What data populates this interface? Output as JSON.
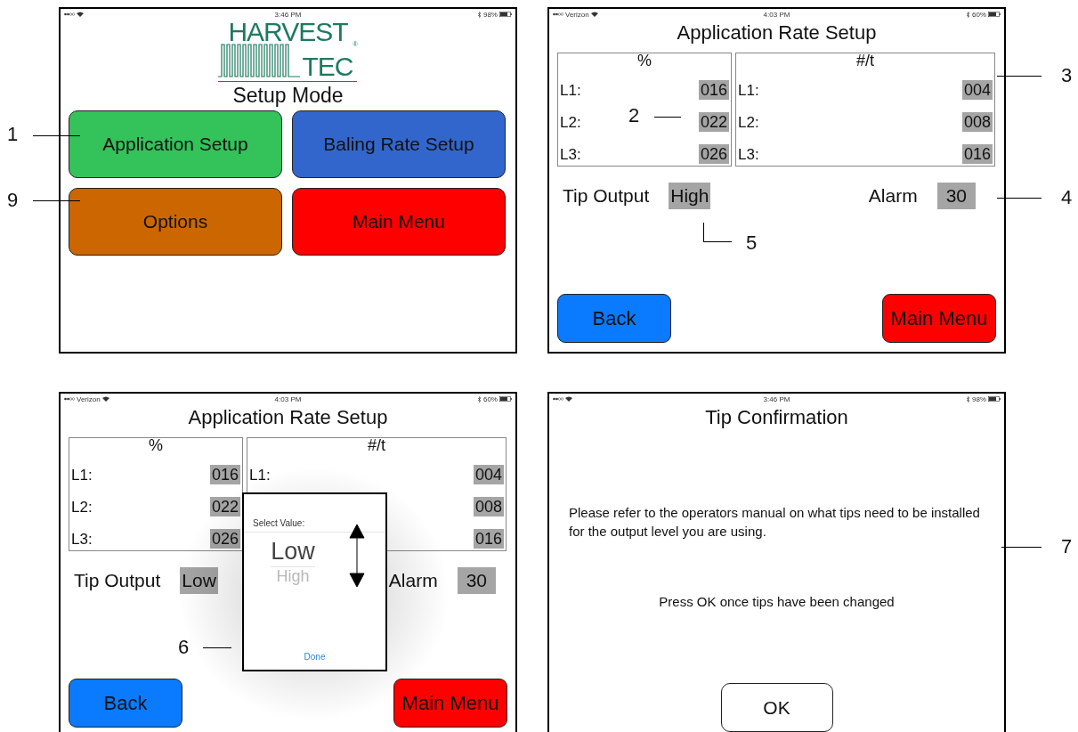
{
  "screens": [
    {
      "kind": "setup_mode",
      "status_bar": {
        "time": "3:46 PM",
        "battery": "98%"
      },
      "logo": {
        "line_1": "HARVEST",
        "line_2": "TEC",
        "mark": "®"
      },
      "title": "Setup Mode",
      "buttons": [
        {
          "label": "Application Setup",
          "color": "#34c25a"
        },
        {
          "label": "Baling Rate Setup",
          "color": "#3366cc"
        },
        {
          "label": "Options",
          "color": "#cc6600"
        },
        {
          "label": "Main Menu",
          "color": "#ff0000"
        }
      ]
    },
    {
      "kind": "rate_setup",
      "status_bar": {
        "carrier": "Verizon",
        "time": "4:03 PM",
        "battery": "60%"
      },
      "title": "Application Rate Setup",
      "percent_panel": {
        "heading": "%",
        "rows": [
          {
            "label": "L1:",
            "value": "016"
          },
          {
            "label": "L2:",
            "value": "022"
          },
          {
            "label": "L3:",
            "value": "026"
          }
        ]
      },
      "rate_panel": {
        "heading": "#/t",
        "rows": [
          {
            "label": "L1:",
            "value": "004"
          },
          {
            "label": "L2:",
            "value": "008"
          },
          {
            "label": "L3:",
            "value": "016"
          }
        ]
      },
      "tip_output": {
        "label": "Tip Output",
        "value": "High"
      },
      "alarm": {
        "label": "Alarm",
        "value": "30"
      },
      "buttons": [
        {
          "label": "Back",
          "color": "#0a7aff"
        },
        {
          "label": "Main Menu",
          "color": "#ff0000"
        }
      ]
    },
    {
      "kind": "rate_setup",
      "status_bar": {
        "carrier": "Verizon",
        "time": "4:03 PM",
        "battery": "60%"
      },
      "title": "Application Rate Setup",
      "percent_panel": {
        "heading": "%",
        "rows": [
          {
            "label": "L1:",
            "value": "016"
          },
          {
            "label": "L2:",
            "value": "022"
          },
          {
            "label": "L3:",
            "value": "026"
          }
        ]
      },
      "rate_panel": {
        "heading": "#/t",
        "rows": [
          {
            "label": "L1:",
            "value": "004"
          },
          {
            "label": "",
            "value": "008"
          },
          {
            "label": "",
            "value": "016"
          }
        ]
      },
      "tip_output": {
        "label": "Tip Output",
        "value": "Low"
      },
      "alarm": {
        "label": "Alarm",
        "value": "30"
      },
      "picker": {
        "prompt": "Select Value:",
        "options": [
          {
            "label": "Low",
            "selected": true
          },
          {
            "label": "High",
            "selected": false
          }
        ],
        "done": "Done"
      },
      "buttons": [
        {
          "label": "Back",
          "color": "#0a7aff"
        },
        {
          "label": "Main Menu",
          "color": "#ff0000"
        }
      ]
    },
    {
      "kind": "tip_confirmation",
      "status_bar": {
        "time": "3:46 PM",
        "battery": "98%"
      },
      "title": "Tip Confirmation",
      "message": "Please refer to the operators manual on what tips need to be installed for the output level you are using.",
      "instruction": "Press OK once tips have been changed",
      "buttons": [
        {
          "label": "OK"
        }
      ]
    }
  ],
  "callouts": [
    {
      "number": "1"
    },
    {
      "number": "9"
    },
    {
      "number": "3"
    },
    {
      "number": "2"
    },
    {
      "number": "4"
    },
    {
      "number": "5"
    },
    {
      "number": "6"
    },
    {
      "number": "7"
    }
  ]
}
